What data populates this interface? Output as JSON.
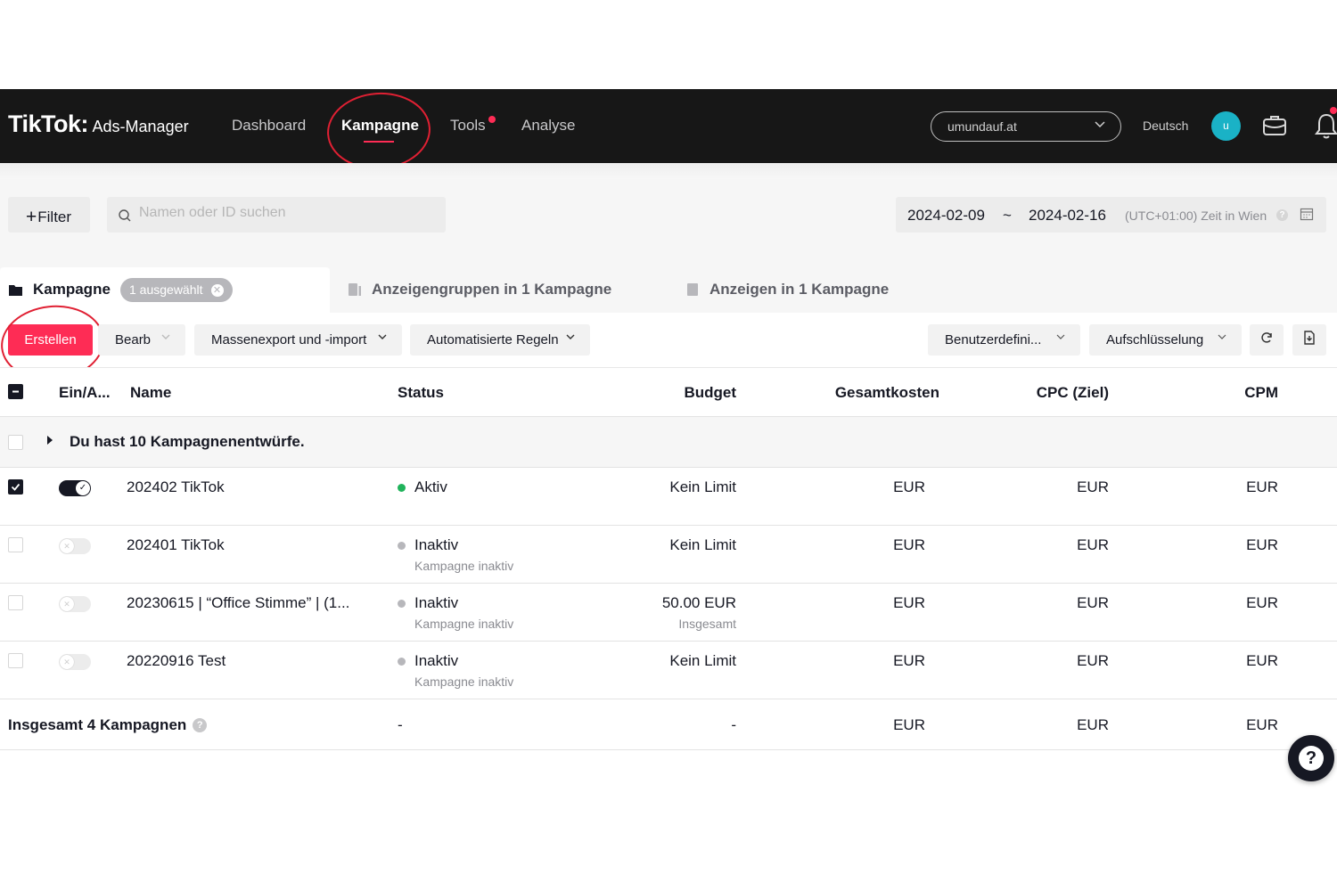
{
  "brand": {
    "logo": "TikTok",
    "colon": ":",
    "product": "Ads-Manager"
  },
  "nav": {
    "items": [
      {
        "label": "Dashboard",
        "active": false
      },
      {
        "label": "Kampagne",
        "active": true
      },
      {
        "label": "Tools",
        "active": false,
        "badge": true
      },
      {
        "label": "Analyse",
        "active": false
      }
    ]
  },
  "header": {
    "account": "umundauf.at",
    "language": "Deutsch",
    "avatar_initial": "u",
    "avatar_color": "#1ab2c6"
  },
  "filters": {
    "filter_label": "Filter",
    "search_placeholder": "Namen oder ID suchen",
    "date_start": "2024-02-09",
    "date_separator": "~",
    "date_end": "2024-02-16",
    "timezone": "(UTC+01:00) Zeit in Wien"
  },
  "tabs": {
    "campaign": "Kampagne",
    "selected_chip": "1 ausgewählt",
    "adgroups": "Anzeigengruppen in 1 Kampagne",
    "ads": "Anzeigen in 1 Kampagne"
  },
  "toolbar": {
    "create": "Erstellen",
    "edit": "Bearb",
    "bulk": "Massenexport und -import",
    "rules": "Automatisierte Regeln",
    "custom": "Benutzerdefini...",
    "breakdown": "Aufschlüsselung"
  },
  "table": {
    "columns": [
      "Ein/A...",
      "Name",
      "Status",
      "Budget",
      "Gesamtkosten",
      "CPC (Ziel)",
      "CPM"
    ],
    "drafts": "Du hast 10 Kampagnenentwürfe.",
    "rows": [
      {
        "checked": true,
        "on": true,
        "name": "202402 TikTok",
        "status": "Aktiv",
        "status_sub": "",
        "status_color": "#20b35b",
        "budget": "Kein Limit",
        "budget_sub": "",
        "cost": "EUR",
        "cpc": "EUR",
        "cpm": "EUR"
      },
      {
        "checked": false,
        "on": false,
        "name": "202401 TikTok",
        "status": "Inaktiv",
        "status_sub": "Kampagne inaktiv",
        "status_color": "#b7b7bb",
        "budget": "Kein Limit",
        "budget_sub": "",
        "cost": "EUR",
        "cpc": "EUR",
        "cpm": "EUR"
      },
      {
        "checked": false,
        "on": false,
        "name": "20230615 | “Office Stimme” | (1...",
        "status": "Inaktiv",
        "status_sub": "Kampagne inaktiv",
        "status_color": "#b7b7bb",
        "budget": "50.00 EUR",
        "budget_sub": "Insgesamt",
        "cost": "EUR",
        "cpc": "EUR",
        "cpm": "EUR"
      },
      {
        "checked": false,
        "on": false,
        "name": "20220916 Test",
        "status": "Inaktiv",
        "status_sub": "Kampagne inaktiv",
        "status_color": "#b7b7bb",
        "budget": "Kein Limit",
        "budget_sub": "",
        "cost": "EUR",
        "cpc": "EUR",
        "cpm": "EUR"
      }
    ],
    "total": {
      "label": "Insgesamt 4 Kampagnen",
      "status": "-",
      "budget": "-",
      "cost": "EUR",
      "cpc": "EUR",
      "cpm": "EUR"
    }
  },
  "colors": {
    "accent": "#fe2c55",
    "navbar": "#171717",
    "annotation": "#e02033"
  }
}
